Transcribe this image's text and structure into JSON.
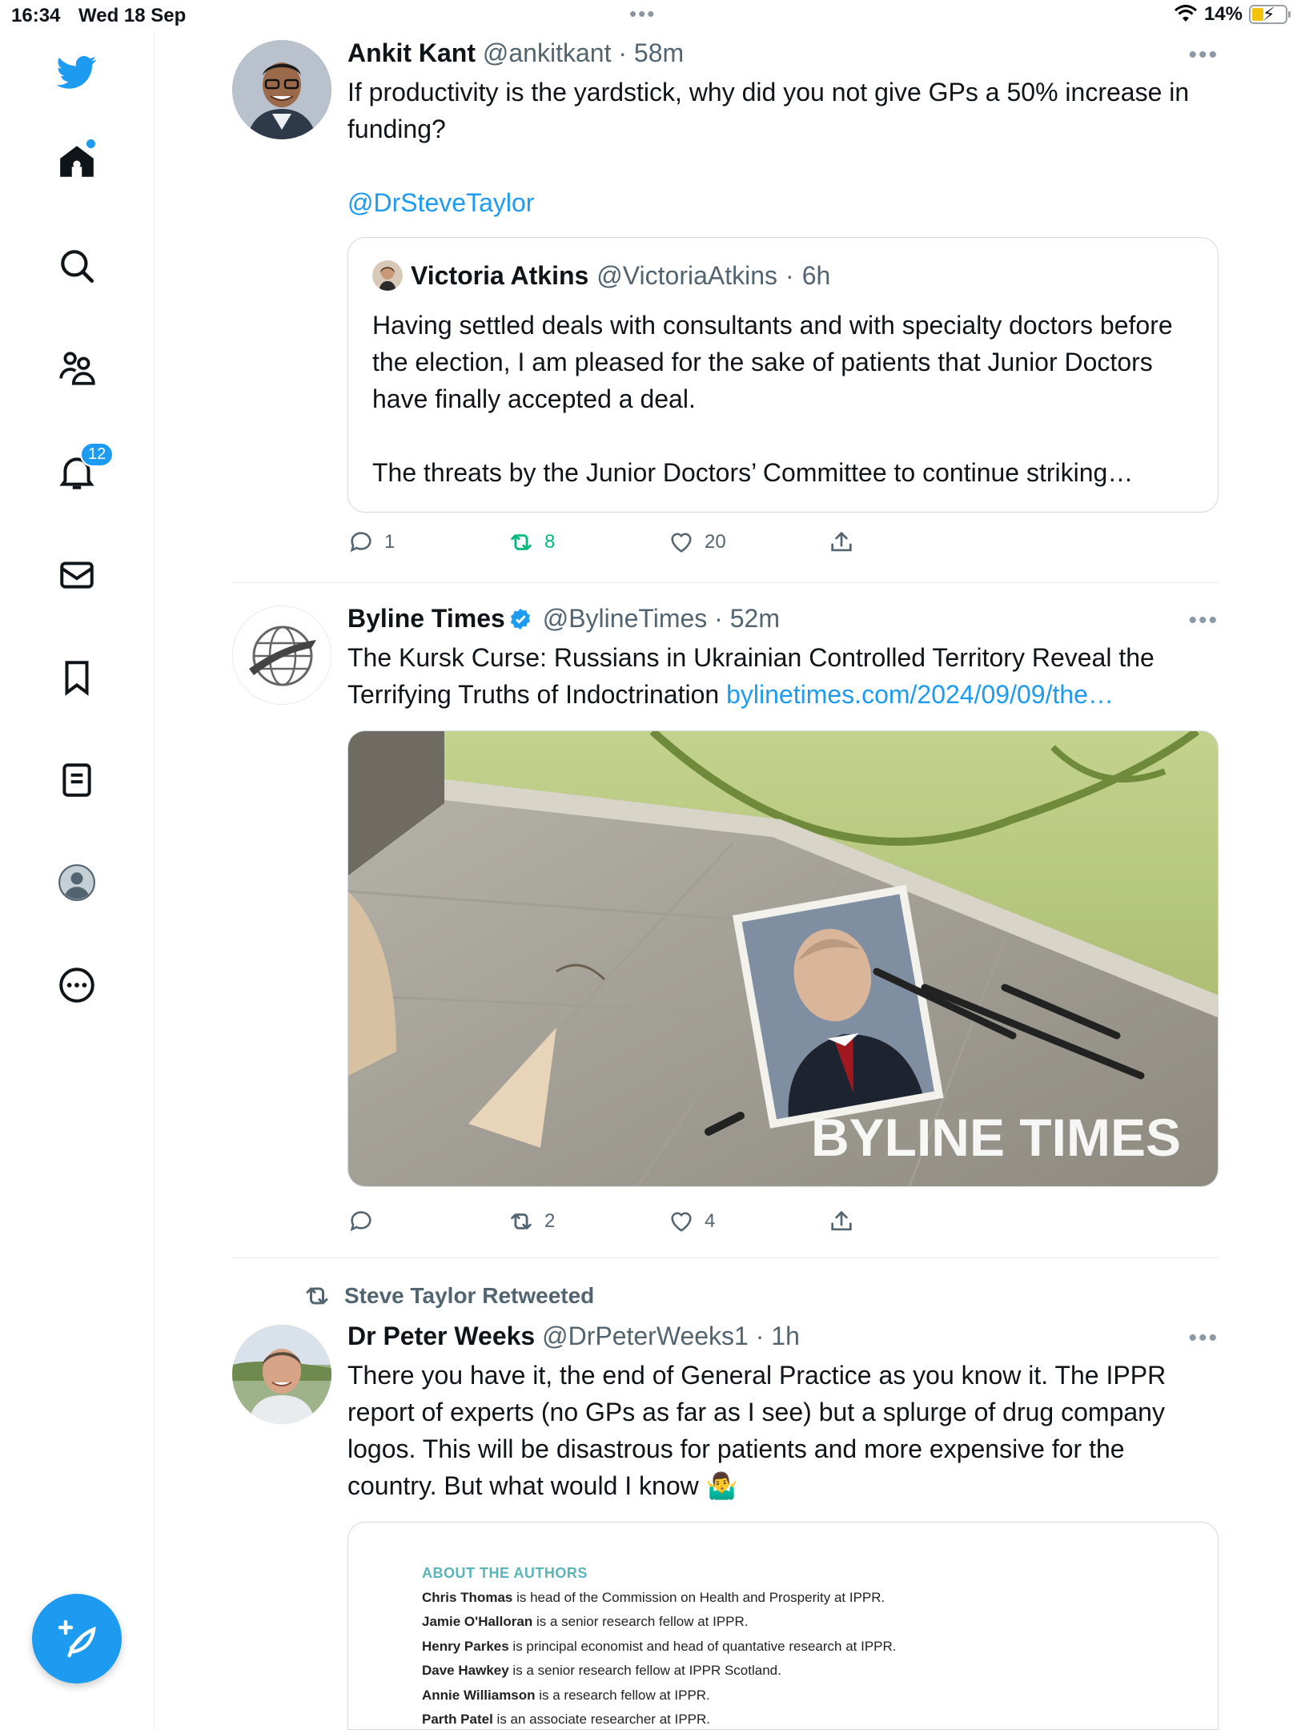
{
  "status_bar": {
    "time": "16:34",
    "date": "Wed 18 Sep",
    "battery": "14%"
  },
  "sidebar": {
    "items": [
      {
        "name": "twitter-logo"
      },
      {
        "name": "home"
      },
      {
        "name": "explore"
      },
      {
        "name": "communities"
      },
      {
        "name": "notifications",
        "badge": "12"
      },
      {
        "name": "messages"
      },
      {
        "name": "bookmarks"
      },
      {
        "name": "lists"
      },
      {
        "name": "profile"
      },
      {
        "name": "more"
      }
    ],
    "accent": "#1d9bf0"
  },
  "tweets": [
    {
      "name": "Ankit Kant",
      "handle": "@ankitkant",
      "sep": "·",
      "time": "58m",
      "text": "If productivity is the yardstick, why did you not give GPs a 50% increase in funding?",
      "mention": "@DrSteveTaylor",
      "quote": {
        "name": "Victoria Atkins",
        "handle": "@VictoriaAtkins",
        "sep": "·",
        "time": "6h",
        "text": "Having settled deals with consultants and with specialty doctors before the election, I am pleased for the sake of patients that Junior Doctors have finally accepted a deal.",
        "text2": "The threats by the Junior Doctors’ Committee to continue striking…"
      },
      "replies": "1",
      "retweets": "8",
      "likes": "20"
    },
    {
      "name": "Byline Times",
      "handle": "@BylineTimes",
      "sep": "·",
      "time": "52m",
      "text": "The Kursk Curse: Russians in Ukrainian Controlled Territory Reveal the Terrifying Truths of Indoctrination",
      "link": "bylinetimes.com/2024/09/09/the…",
      "watermark": "BYLINE TIMES",
      "replies": "",
      "retweets": "2",
      "likes": "4"
    },
    {
      "retweeted_by": "Steve Taylor Retweeted",
      "name": "Dr Peter Weeks",
      "handle": "@DrPeterWeeks1",
      "sep": "·",
      "time": "1h",
      "text": "There you have it, the end of General Practice as you know it. The IPPR report of experts (no GPs as far as I see) but a splurge of drug company logos. This will be disastrous for patients and more expensive for the country. But what would I know 🤷‍♂️",
      "doc": {
        "title": "ABOUT THE AUTHORS",
        "lines": [
          {
            "bold": "Chris Thomas",
            "rest": " is head of the Commission on Health and Prosperity at IPPR."
          },
          {
            "bold": "Jamie O'Halloran",
            "rest": " is a senior research fellow at IPPR."
          },
          {
            "bold": "Henry Parkes",
            "rest": " is principal economist and head of quantative research at IPPR."
          },
          {
            "bold": "Dave Hawkey",
            "rest": " is a senior research fellow at IPPR Scotland."
          },
          {
            "bold": "Annie Williamson",
            "rest": " is a research fellow at IPPR."
          },
          {
            "bold": "Parth Patel",
            "rest": " is an associate researcher at IPPR."
          }
        ]
      }
    }
  ]
}
